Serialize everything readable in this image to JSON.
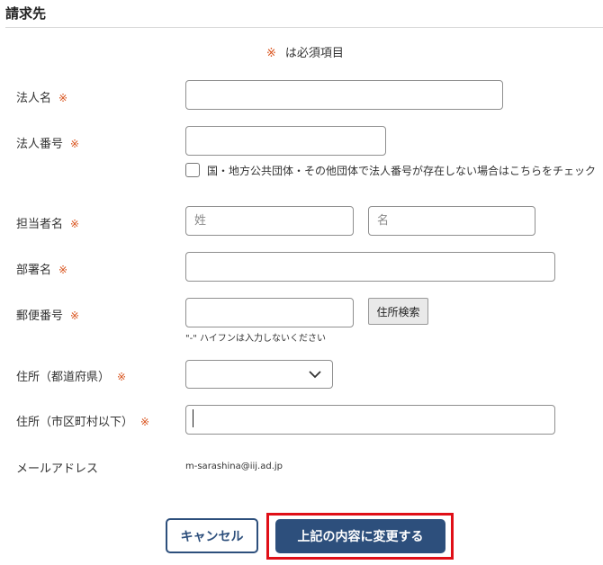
{
  "section": {
    "title": "請求先"
  },
  "required_note": {
    "mark": "※",
    "text": "は必須項目"
  },
  "required_mark": "※",
  "fields": {
    "corp_name": {
      "label": "法人名",
      "value": ""
    },
    "corp_number": {
      "label": "法人番号",
      "value": ""
    },
    "no_corp_number": {
      "label": "国・地方公共団体・その他団体で法人番号が存在しない場合はこちらをチェック",
      "checked": false
    },
    "contact_name": {
      "label": "担当者名",
      "last_placeholder": "姓",
      "first_placeholder": "名"
    },
    "department": {
      "label": "部署名",
      "value": ""
    },
    "postal_code": {
      "label": "郵便番号",
      "value": "",
      "hint": "\"-\" ハイフンは入力しないください"
    },
    "address_search": {
      "label": "住所検索"
    },
    "prefecture": {
      "label": "住所（都道府県）",
      "selected": ""
    },
    "city": {
      "label": "住所（市区町村以下）",
      "value": ""
    },
    "email": {
      "label": "メールアドレス",
      "value": "m-sarashina@iij.ad.jp"
    }
  },
  "actions": {
    "cancel": "キャンセル",
    "submit": "上記の内容に変更する"
  },
  "colors": {
    "accent": "#2d4f7c",
    "required": "#d9541e",
    "highlight": "#e00f17"
  }
}
